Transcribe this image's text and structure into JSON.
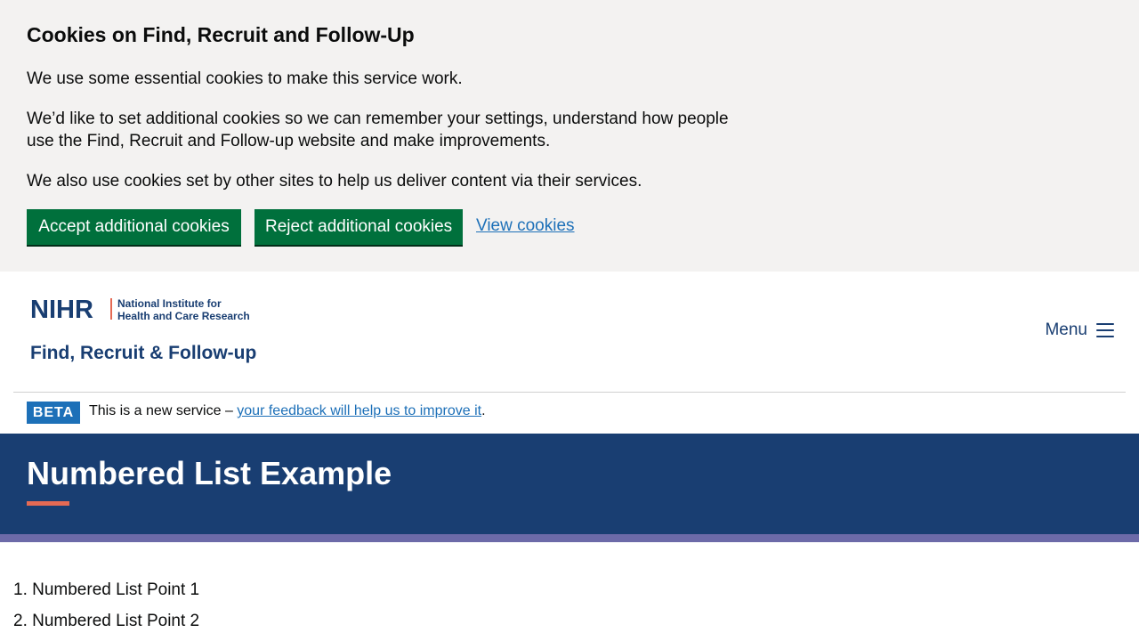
{
  "cookie_banner": {
    "title": "Cookies on Find, Recruit and Follow-Up",
    "paragraph_1": "We use some essential cookies to make this service work.",
    "paragraph_2": "We’d like to set additional cookies so we can remember your settings, understand how people use the Find, Recruit and Follow-up website and make improvements.",
    "paragraph_3": "We also use cookies set by other sites to help us deliver content via their services.",
    "accept_label": "Accept additional cookies",
    "reject_label": "Reject additional cookies",
    "view_label": "View cookies"
  },
  "header": {
    "logo_org": "NIHR",
    "logo_institute_line1": "National Institute for",
    "logo_institute_line2": "Health and Care Research",
    "service_name": "Find, Recruit & Follow-up",
    "menu_label": "Menu",
    "menu_icon": "hamburger-icon"
  },
  "beta": {
    "tag": "BETA",
    "text_before": "This is a new service – ",
    "link_text": "your feedback will help us to improve it",
    "text_after": "."
  },
  "hero": {
    "title": "Numbered List Example"
  },
  "list": {
    "items": [
      "1. Numbered List Point 1",
      "2. Numbered List Point 2"
    ]
  },
  "colors": {
    "cookie_background": "#f3f2f1",
    "button_green": "#00703c",
    "link_blue": "#1d70b8",
    "brand_navy": "#193e72",
    "accent_coral": "#e56a54",
    "stripe_purple": "#6c6aa8"
  }
}
